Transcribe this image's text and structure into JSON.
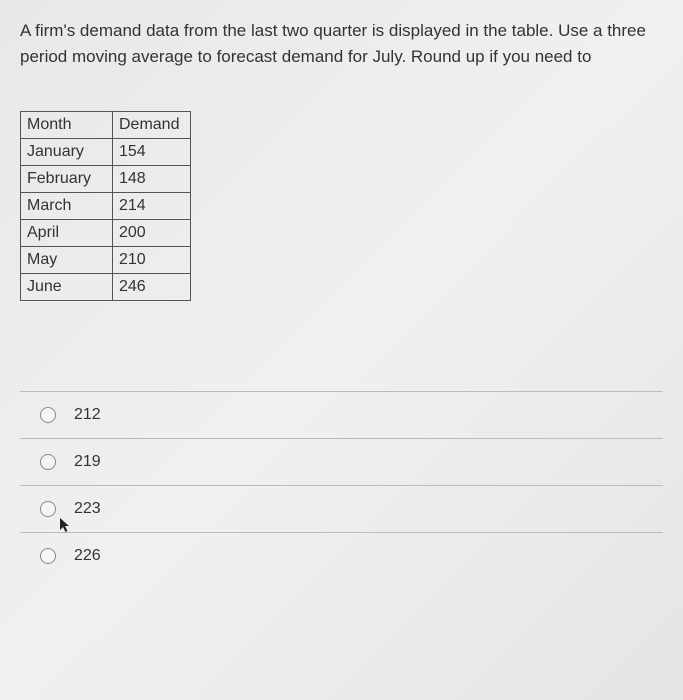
{
  "question": "A firm's demand data from the last two quarter is displayed in the table. Use a three period moving average to forecast demand for July. Round up if you need to",
  "table": {
    "headers": [
      "Month",
      "Demand"
    ],
    "rows": [
      {
        "month": "January",
        "demand": "154"
      },
      {
        "month": "February",
        "demand": "148"
      },
      {
        "month": "March",
        "demand": "214"
      },
      {
        "month": "April",
        "demand": "200"
      },
      {
        "month": "May",
        "demand": "210"
      },
      {
        "month": "June",
        "demand": "246"
      }
    ]
  },
  "options": [
    {
      "value": "212"
    },
    {
      "value": "219"
    },
    {
      "value": "223"
    },
    {
      "value": "226"
    }
  ]
}
